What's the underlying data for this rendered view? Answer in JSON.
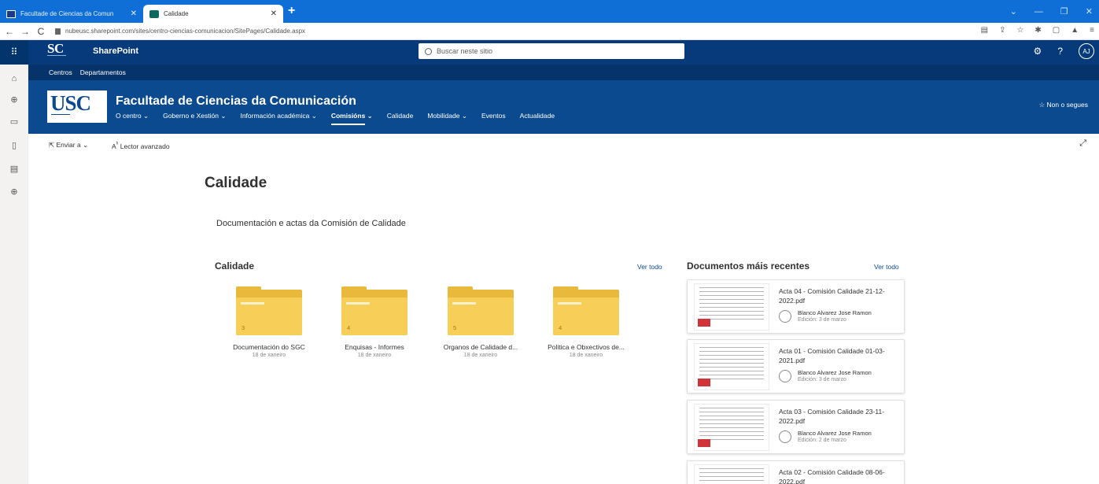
{
  "browser": {
    "tabs": [
      {
        "label": "Facultade de Ciencias da Comun"
      },
      {
        "label": "Calidade"
      }
    ],
    "new_tab": "+",
    "url": "nubeusc.sharepoint.com/sites/centro-ciencias-comunicacion/SitePages/Calidade.aspx",
    "nav": {
      "back": "←",
      "forward": "→",
      "refresh": "C"
    }
  },
  "suite": {
    "logo": "SC",
    "app_name": "SharePoint",
    "search_placeholder": "Buscar neste sitio",
    "help": "?",
    "avatar": "AJ"
  },
  "hubnav": [
    "Centros",
    "Departamentos"
  ],
  "site": {
    "logo": "USC",
    "title": "Facultade de Ciencias da Comunicación",
    "nav": [
      {
        "label": "O centro ⌄"
      },
      {
        "label": "Goberno e Xestión ⌄"
      },
      {
        "label": "Información académica ⌄"
      },
      {
        "label": "Comisións ⌄"
      },
      {
        "label": "Calidade"
      },
      {
        "label": "Mobilidade ⌄"
      },
      {
        "label": "Eventos"
      },
      {
        "label": "Actualidade"
      }
    ],
    "follow": "☆ Non o segues"
  },
  "commandbar": {
    "send": "Enviar a ⌄",
    "reader": "Lector avanzado",
    "expand": "⤢"
  },
  "page": {
    "title": "Calidade",
    "description": "Documentación e actas da Comisión de Calidade"
  },
  "library": {
    "title": "Calidade",
    "see_all": "Ver todo",
    "folders": [
      {
        "name": "Documentación do SGC",
        "count": "3",
        "date": "18 de xaneiro"
      },
      {
        "name": "Enquisas - Informes",
        "count": "4",
        "date": "18 de xaneiro"
      },
      {
        "name": "Organos de Calidade d...",
        "count": "5",
        "date": "18 de xaneiro"
      },
      {
        "name": "Politica e Obxectivos de...",
        "count": "4",
        "date": "18 de xaneiro"
      }
    ]
  },
  "recent": {
    "title": "Documentos máis recentes",
    "see_all": "Ver todo",
    "docs": [
      {
        "title": "Acta 04 - Comisión Calidade 21-12-2022.pdf",
        "author": "Blanco Alvarez Jose Ramon",
        "edited": "Edición: 3 de marzo"
      },
      {
        "title": "Acta 01 - Comisión Calidade 01-03-2021.pdf",
        "author": "Blanco Alvarez Jose Ramon",
        "edited": "Edición: 3 de marzo"
      },
      {
        "title": "Acta 03 - Comisión Calidade 23-11-2022.pdf",
        "author": "Blanco Alvarez Jose Ramon",
        "edited": "Edición: 2 de marzo"
      },
      {
        "title": "Acta 02 - Comisión Calidade 08-06-2022.pdf",
        "author": "",
        "edited": ""
      }
    ]
  },
  "colors": {
    "tabstrip": "#0f6fd7",
    "suitebar": "#073a7a",
    "siteheader": "#0b4a8e",
    "folder": "#f7cf58"
  }
}
